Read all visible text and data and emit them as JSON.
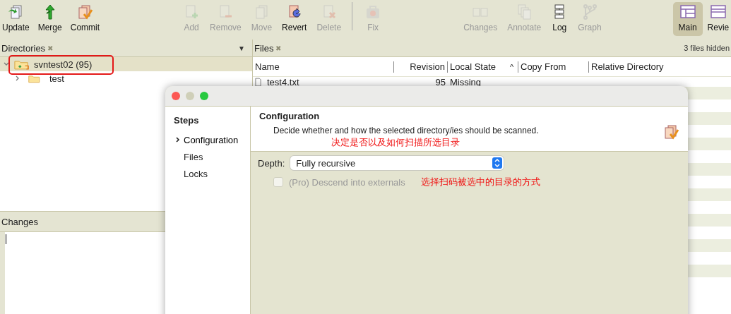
{
  "toolbar": [
    {
      "items": [
        {
          "label": "Update",
          "disabled": false
        },
        {
          "label": "Merge",
          "disabled": false
        },
        {
          "label": "Commit",
          "disabled": false
        }
      ]
    },
    {
      "items": [
        {
          "label": "Add",
          "disabled": true
        },
        {
          "label": "Remove",
          "disabled": true
        },
        {
          "label": "Move",
          "disabled": true
        },
        {
          "label": "Revert",
          "disabled": false
        },
        {
          "label": "Delete",
          "disabled": true
        }
      ]
    },
    {
      "items": [
        {
          "label": "Fix",
          "disabled": true
        }
      ]
    },
    {
      "items": [
        {
          "label": "Changes",
          "disabled": true
        },
        {
          "label": "Annotate",
          "disabled": true
        },
        {
          "label": "Log",
          "disabled": false
        },
        {
          "label": "Graph",
          "disabled": true
        }
      ]
    },
    {
      "items": [
        {
          "label": "Main",
          "selected": true
        },
        {
          "label": "Revie",
          "selected": false
        }
      ]
    }
  ],
  "directories": {
    "title": "Directories",
    "close": "✖",
    "menu": "▼",
    "tree": [
      {
        "label": "svntest02 (95)",
        "selected": true,
        "expanded": true,
        "children": [
          {
            "label": "test",
            "selected": false,
            "expanded": false
          }
        ]
      }
    ]
  },
  "files": {
    "title": "Files",
    "close": "✖",
    "hidden_note": "3 files hidden",
    "sort_mark": "^",
    "columns": [
      "Name",
      "Revision",
      "Local State",
      "Copy From",
      "Relative Directory"
    ],
    "rows": [
      {
        "name": "test4.txt",
        "revision": "95",
        "local_state": "Missing"
      }
    ]
  },
  "changes": {
    "title": "Changes"
  },
  "dialog": {
    "steps_title": "Steps",
    "steps": [
      {
        "label": "Configuration",
        "selected": true
      },
      {
        "label": "Files",
        "selected": false
      },
      {
        "label": "Locks",
        "selected": false
      }
    ],
    "title": "Configuration",
    "description": "Decide whether and how the selected directory/ies should be scanned.",
    "description_note": "决定是否以及如何扫描所选目录",
    "depth_label": "Depth:",
    "depth_value": "Fully recursive",
    "externals": {
      "label": "(Pro) Descend into externals",
      "checked": false,
      "disabled": true
    },
    "externals_note": "选择扫码被选中的目录的方式"
  }
}
